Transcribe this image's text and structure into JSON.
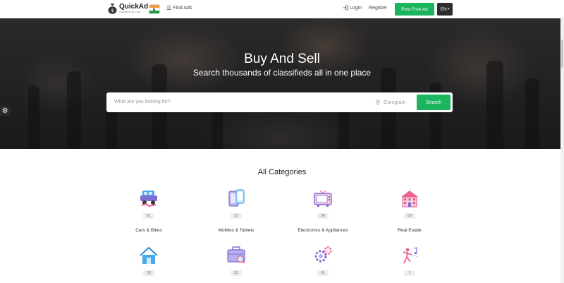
{
  "nav": {
    "brand_name": "QuickAd",
    "brand_tagline": "Classified Ads CMS",
    "find_ads": "Find Ads",
    "login": "Login",
    "register": "Register",
    "post_free_ad": "Post Free Ad",
    "language": "EN"
  },
  "hero": {
    "title": "Buy And Sell",
    "subtitle": "Search thousands of classifieds all in one place",
    "search_placeholder": "What are you looking for?",
    "location": "Gurugram",
    "search_button": "Search"
  },
  "categories": {
    "title": "All Categories",
    "items": [
      {
        "name": "Cars & Bikes",
        "count": "61",
        "icon": "car-bike-icon"
      },
      {
        "name": "Mobiles & Tablets",
        "count": "33",
        "icon": "mobile-tablet-icon"
      },
      {
        "name": "Electronics & Appliances",
        "count": "36",
        "icon": "tv-icon"
      },
      {
        "name": "Real Estate",
        "count": "59",
        "icon": "building-icon"
      },
      {
        "name": "",
        "count": "33",
        "icon": "home-icon"
      },
      {
        "name": "",
        "count": "33",
        "icon": "briefcase-search-icon"
      },
      {
        "name": "",
        "count": "91",
        "icon": "gears-icon"
      },
      {
        "name": "",
        "count": "7",
        "icon": "dancer-music-icon"
      }
    ]
  },
  "colors": {
    "accent": "#1ab55d",
    "dark": "#2d2d2d",
    "icon_purple": "#7b6fd6",
    "icon_blue": "#4aa8e8",
    "icon_pink": "#f06292"
  }
}
